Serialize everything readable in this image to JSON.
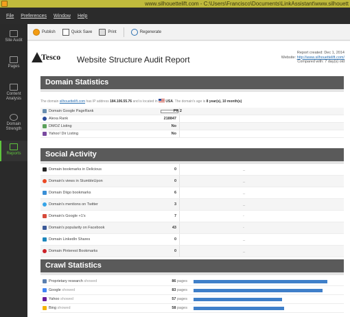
{
  "window": {
    "title": "www.silhouettelift.com - C:\\Users\\Francisco\\Documents\\LinkAssistant\\www.silhouett"
  },
  "menu": [
    "File",
    "Preferences",
    "Window",
    "Help"
  ],
  "sidebar": {
    "items": [
      {
        "label": "Site Audit",
        "icon": "site-audit-icon",
        "active": false
      },
      {
        "label": "Pages",
        "icon": "pages-icon",
        "active": false
      },
      {
        "label": "Content Analysis",
        "icon": "content-analysis-icon",
        "active": false
      },
      {
        "label": "Domain Strength",
        "icon": "domain-strength-icon",
        "active": false
      },
      {
        "label": "Reports",
        "icon": "reports-icon",
        "active": true
      }
    ]
  },
  "toolbar": {
    "publish": "Publish",
    "quick_save": "Quick Save",
    "print": "Print",
    "regenerate": "Regenerate"
  },
  "report": {
    "logo_text": "Tesco",
    "title": "Website Structure Audit Report",
    "meta": {
      "created": "Report created: Dec 1, 2014",
      "website_prefix": "Website:",
      "website_link": "http://www.silhouettelift.com/",
      "compared": "Compared with: 7 day(s) old"
    }
  },
  "domain_statistics": {
    "header": "Domain Statistics",
    "intro": {
      "p1": "The domain",
      "domain_link": "silhouettelift.com",
      "p2": "has IP address",
      "ip": "184.106.55.76",
      "p3": "and is located in",
      "country": "USA",
      "p4": ". The domain's age is",
      "age": "8 year(s), 10 month(s)"
    },
    "rows": [
      {
        "label": "Domain Google PageRank",
        "value": "PR 2",
        "icon": "google-pagerank-icon",
        "pagerank_fraction": 0.2
      },
      {
        "label": "Alexa Rank",
        "value": "218847",
        "icon": "alexa-icon"
      },
      {
        "label": "DMOZ Listing",
        "value": "No",
        "icon": "dmoz-icon"
      },
      {
        "label": "Yahoo! Dir Listing",
        "value": "No",
        "icon": "yahoo-dir-icon"
      }
    ]
  },
  "social_activity": {
    "header": "Social Activity",
    "rows": [
      {
        "label": "Domain bookmarks in Delicious",
        "value": "0",
        "icon": "delicious-icon",
        "trend": "_"
      },
      {
        "label": "Domain's views in StumbleUpon",
        "value": "0",
        "icon": "stumbleupon-icon",
        "trend": "_"
      },
      {
        "label": "Domain Diigo bookmarks",
        "value": "6",
        "icon": "diigo-icon",
        "trend": "_"
      },
      {
        "label": "Domain's mentions on Twitter",
        "value": "3",
        "icon": "twitter-icon",
        "trend": "_"
      },
      {
        "label": "Domain's Google +1's",
        "value": "7",
        "icon": "google-plus-icon",
        "trend": "-"
      },
      {
        "label": "Domain's popularity on Facebook",
        "value": "43",
        "icon": "facebook-icon",
        "trend": "-"
      },
      {
        "label": "Domain LinkedIn Shares",
        "value": "0",
        "icon": "linkedin-icon",
        "trend": "_"
      },
      {
        "label": "Domain Pinterest Bookmarks",
        "value": "0",
        "icon": "pinterest-icon",
        "trend": "_"
      }
    ]
  },
  "crawl_statistics": {
    "header": "Crawl Statistics",
    "unit": "pages",
    "rows": [
      {
        "label": "Proprietary research",
        "sub": "showed",
        "value": 86,
        "icon": "research-icon"
      },
      {
        "label": "Google",
        "sub": "showed",
        "value": 83,
        "icon": "google-icon"
      },
      {
        "label": "Yahoo",
        "sub": "showed",
        "value": 57,
        "icon": "yahoo-icon"
      },
      {
        "label": "Bing",
        "sub": "showed",
        "value": 58,
        "icon": "bing-icon"
      }
    ]
  },
  "colors": {
    "accent_green": "#5fc63d",
    "section_header": "#5a5a5a",
    "bar_blue": "#3f7fc9",
    "link": "#2a6fb0"
  }
}
